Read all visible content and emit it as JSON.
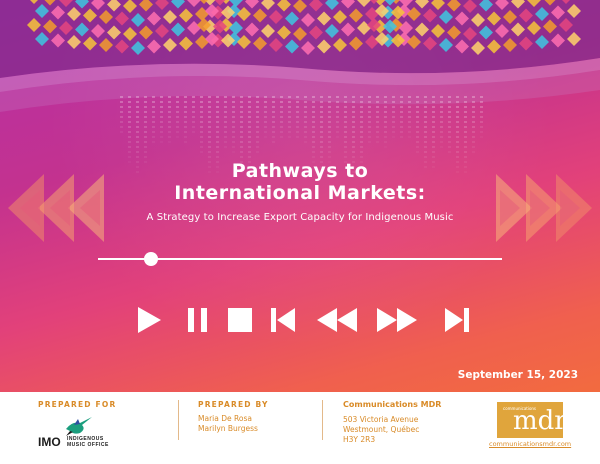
{
  "cover": {
    "title_line1": "Pathways to",
    "title_line2": "International Markets:",
    "subtitle": "A Strategy to Increase Export Capacity for Indigenous Music",
    "date": "September 15, 2023",
    "seek_progress": 0.13
  },
  "controls": [
    {
      "icon": "play-icon"
    },
    {
      "icon": "pause-icon"
    },
    {
      "icon": "stop-icon"
    },
    {
      "icon": "skip-back-icon"
    },
    {
      "icon": "rewind-icon"
    },
    {
      "icon": "fast-forward-icon"
    },
    {
      "icon": "skip-forward-icon"
    }
  ],
  "footer": {
    "prepared_for": {
      "label": "PREPARED FOR",
      "logo_text": "IMO",
      "logo_sub1": "INDIGENOUS",
      "logo_sub2": "MUSIC OFFICE"
    },
    "prepared_by": {
      "label": "PREPARED BY",
      "names": [
        "Maria De Rosa",
        "Marilyn Burgess"
      ]
    },
    "company": {
      "name": "Communications MDR",
      "address": [
        "503 Victoria Avenue",
        "Westmount, Québec",
        "H3Y 2R3"
      ],
      "logo_small": "communications",
      "logo_big": "mdr",
      "url": "communicationsmdr.com"
    }
  },
  "colors": {
    "accent_orange": "#d98b28",
    "logo_gold": "#e0a53c"
  }
}
